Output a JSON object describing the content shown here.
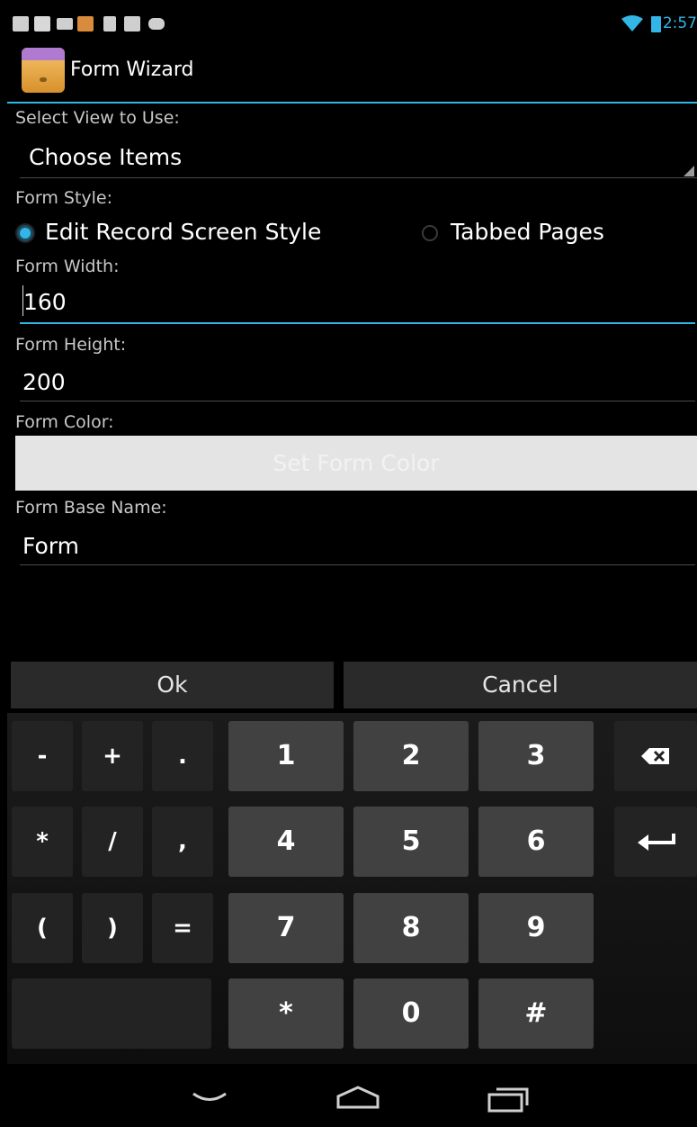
{
  "status_bar": {
    "time": "2:57",
    "left_icons": [
      "image-icon",
      "gmail-icon",
      "mail-icon",
      "app-icon",
      "download-icon",
      "shop-icon",
      "android-icon"
    ],
    "right_icons": [
      "wifi-icon",
      "battery-icon"
    ]
  },
  "action_bar": {
    "title": "Form Wizard",
    "icon": "drawer-icon"
  },
  "form": {
    "select_view_label": "Select View to Use:",
    "select_view_value": "Choose Items",
    "form_style_label": "Form Style:",
    "style_option_1": "Edit Record Screen Style",
    "style_option_2": "Tabbed Pages",
    "style_selected": "Edit Record Screen Style",
    "form_width_label": "Form Width:",
    "form_width_value": "160",
    "form_height_label": "Form Height:",
    "form_height_value": "200",
    "form_color_label": "Form Color:",
    "set_color_label": "Set Form Color",
    "form_base_name_label": "Form Base Name:",
    "form_base_name_value": "Form"
  },
  "buttons": {
    "ok": "Ok",
    "cancel": "Cancel"
  },
  "keyboard": {
    "row1": [
      "-",
      "+",
      ".",
      "1",
      "2",
      "3"
    ],
    "row2": [
      "*",
      "/",
      ",",
      "4",
      "5",
      "6"
    ],
    "row3": [
      "(",
      ")",
      "=",
      "7",
      "8",
      "9"
    ],
    "row4": [
      "*",
      "0",
      "#"
    ]
  },
  "colors": {
    "accent": "#33b5e5",
    "background": "#000000"
  }
}
